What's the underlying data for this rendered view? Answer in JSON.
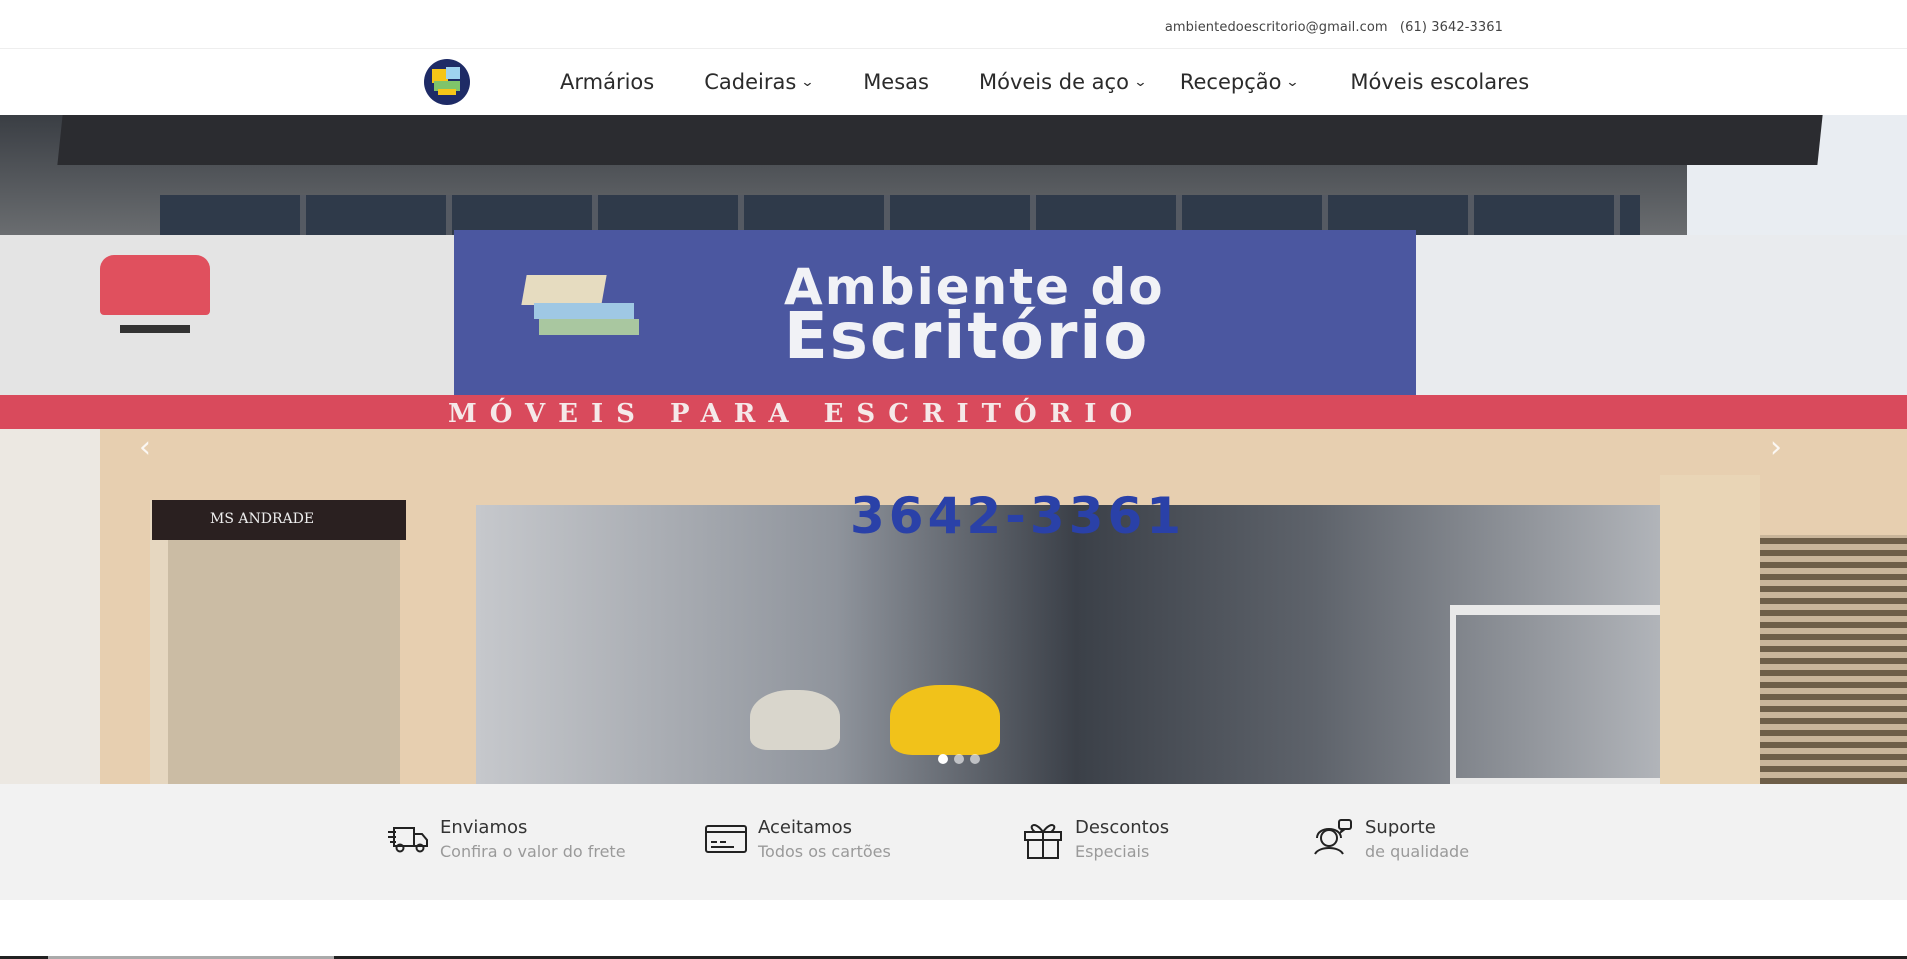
{
  "topbar": {
    "email": "ambientedoescritorio@gmail.com",
    "phone": "(61) 3642-3361"
  },
  "nav": {
    "logo_icon": "store-logo",
    "items": [
      {
        "label": "Armários",
        "dropdown": false
      },
      {
        "label": "Cadeiras",
        "dropdown": true
      },
      {
        "label": "Mesas",
        "dropdown": false
      },
      {
        "label": "Móveis de aço",
        "dropdown": true
      },
      {
        "label": "Recepção",
        "dropdown": true
      },
      {
        "label": "Móveis escolares",
        "dropdown": false
      }
    ],
    "chevron": "⌄"
  },
  "hero": {
    "sign_line1": "Ambiente do",
    "sign_line2": "Escritório",
    "band_text": "MÓVEIS PARA ESCRITÓRIO",
    "phone_sign": "3642-3361",
    "plaque": "MS ANDRADE",
    "prev_arrow": "‹",
    "next_arrow": "›",
    "slides_total": 3,
    "active_slide": 1
  },
  "features": [
    {
      "icon": "delivery-truck-icon",
      "title": "Enviamos",
      "subtitle": "Confira o valor do frete"
    },
    {
      "icon": "credit-card-icon",
      "title": "Aceitamos",
      "subtitle": "Todos os cartões"
    },
    {
      "icon": "gift-icon",
      "title": "Descontos",
      "subtitle": "Especiais"
    },
    {
      "icon": "support-agent-icon",
      "title": "Suporte",
      "subtitle": "de qualidade"
    }
  ],
  "colors": {
    "sign_blue": "#4b57a0",
    "band_red": "#d94a5c",
    "features_bg": "#f2f2f2"
  }
}
